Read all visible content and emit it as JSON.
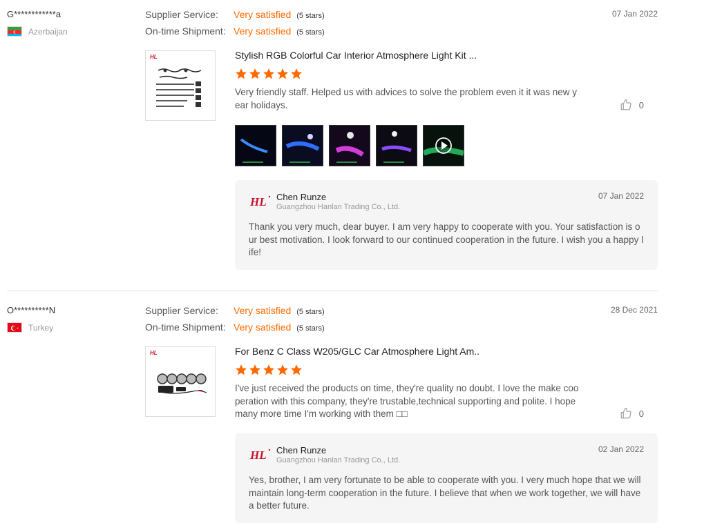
{
  "reviews": [
    {
      "buyer": "G************a",
      "country": "Azerbaijan",
      "supplier_service_label": "Supplier Service:",
      "supplier_service_value": "Very satisfied",
      "supplier_service_stars": "(5 stars)",
      "shipment_label": "On-time Shipment:",
      "shipment_value": "Very satisfied",
      "shipment_stars": "(5 stars)",
      "date": "07 Jan 2022",
      "product_title": "Stylish RGB Colorful Car Interior Atmosphere Light Kit ...",
      "product_brand": "HL",
      "rating": 5,
      "text": "Very friendly staff. Helped us with advices to solve the problem even it it was new year holidays.",
      "likes": "0",
      "reply": {
        "logo": "HL",
        "name": "Chen Runze",
        "company": "Guangzhou Hanlan Trading Co., Ltd.",
        "date": "07 Jan 2022",
        "text": "Thank you very much, dear buyer. I am very happy to cooperate with you. Your satisfaction is our best motivation. I look forward to our continued cooperation in the future. I wish you a happy life!"
      }
    },
    {
      "buyer": "O**********N",
      "country": "Turkey",
      "supplier_service_label": "Supplier Service:",
      "supplier_service_value": "Very satisfied",
      "supplier_service_stars": "(5 stars)",
      "shipment_label": "On-time Shipment:",
      "shipment_value": "Very satisfied",
      "shipment_stars": "(5 stars)",
      "date": "28 Dec 2021",
      "product_title": "For Benz C Class W205/GLC Car Atmosphere Light Am..",
      "product_brand": "HL",
      "rating": 5,
      "text": "I've just received the products on time, they're quality no doubt. I love the make cooperation with this company, they're trustable,technical supporting and polite. I hope many more time I'm working with them □□",
      "likes": "0",
      "reply": {
        "logo": "HL",
        "name": "Chen Runze",
        "company": "Guangzhou Hanlan Trading Co., Ltd.",
        "date": "02 Jan 2022",
        "text": "Yes, brother, I am very fortunate to be able to cooperate with you. I very much hope that we will maintain long-term cooperation in the future. I believe that when we work together, we will have a better future."
      }
    }
  ],
  "colors": {
    "accent": "#ff6a00",
    "reply_bg": "#f5f5f5",
    "brand_red": "#c8102e"
  },
  "icons": {
    "rating_star": "star-icon",
    "like": "thumbs-up-icon",
    "video": "play-icon",
    "flags": [
      "azerbaijan-flag-icon",
      "turkey-flag-icon"
    ]
  }
}
